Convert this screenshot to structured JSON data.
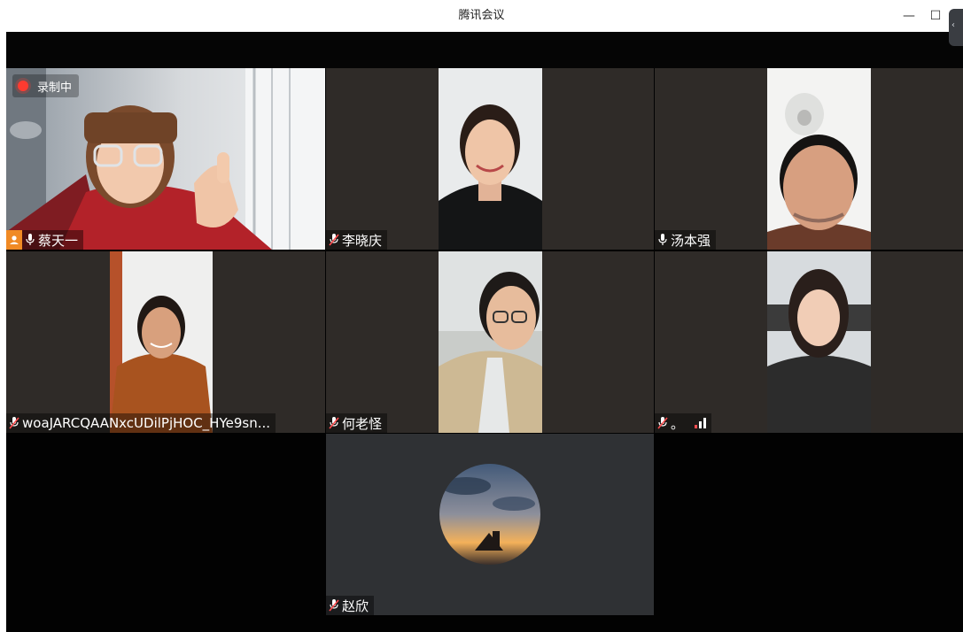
{
  "window": {
    "title": "腾讯会议",
    "minimize_glyph": "—",
    "maximize_glyph": "☐"
  },
  "recording": {
    "label": "录制中"
  },
  "participants": [
    {
      "name": "蔡天一",
      "mic": "on",
      "host": true
    },
    {
      "name": "李晓庆",
      "mic": "muted"
    },
    {
      "name": "汤本强",
      "mic": "on"
    },
    {
      "name": "woaJARCQAANxcUDilPjHOC_HYe9sn...",
      "mic": "muted"
    },
    {
      "name": "何老怪",
      "mic": "muted"
    },
    {
      "name": "。",
      "mic": "muted",
      "signal": "weak"
    },
    {
      "name": "赵欣",
      "mic": "muted",
      "video": "off"
    }
  ],
  "icons": {
    "mic_on": "microphone-icon",
    "mic_muted": "microphone-muted-icon",
    "host": "host-person-icon",
    "record": "record-dot-icon",
    "signal": "signal-bars-icon"
  },
  "colors": {
    "active_speaker_border": "#39c36b",
    "host_badge": "#f08a24",
    "record_dot": "#ff3b30",
    "tile_bg": "#2f2b28",
    "stage_bg": "#020202"
  }
}
